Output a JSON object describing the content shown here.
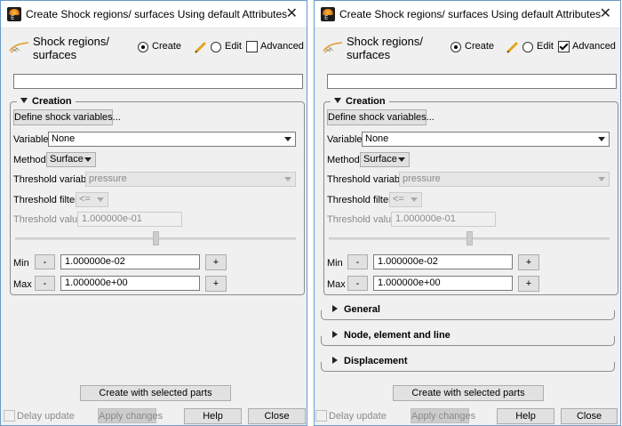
{
  "windows": [
    {
      "title": "Create Shock regions/ surfaces Using default Attributes",
      "tool_title_line1": "Shock regions/",
      "tool_title_line2": "surfaces",
      "mode_create": "Create",
      "mode_edit": "Edit",
      "advanced": "Advanced",
      "advanced_checked": false,
      "name_value": "",
      "creation": {
        "header": "Creation",
        "define_button": "Define shock variables...",
        "variable_label": "Variable",
        "variable_value": "None",
        "method_label": "Method",
        "method_value": "Surface",
        "threshold_variable_label": "Threshold variable",
        "threshold_variable_value": "pressure",
        "threshold_filter_label": "Threshold filter",
        "threshold_filter_value": "<=",
        "threshold_value_label": "Threshold value",
        "threshold_value": "1.000000e-01",
        "slider_level": 0.5,
        "min_label": "Min",
        "min_value": "1.000000e-02",
        "max_label": "Max",
        "max_value": "1.000000e+00",
        "minus": "-",
        "plus": "+"
      },
      "collapsed_sections": [],
      "create_button": "Create with selected parts",
      "delay_update": "Delay update",
      "apply_changes": "Apply changes",
      "help": "Help",
      "close": "Close"
    },
    {
      "title": "Create Shock regions/ surfaces Using default Attributes",
      "tool_title_line1": "Shock regions/",
      "tool_title_line2": "surfaces",
      "mode_create": "Create",
      "mode_edit": "Edit",
      "advanced": "Advanced",
      "advanced_checked": true,
      "name_value": "",
      "creation": {
        "header": "Creation",
        "define_button": "Define shock variables...",
        "variable_label": "Variable",
        "variable_value": "None",
        "method_label": "Method",
        "method_value": "Surface",
        "threshold_variable_label": "Threshold variable",
        "threshold_variable_value": "pressure",
        "threshold_filter_label": "Threshold filter",
        "threshold_filter_value": "<=",
        "threshold_value_label": "Threshold value",
        "threshold_value": "1.000000e-01",
        "slider_level": 0.5,
        "min_label": "Min",
        "min_value": "1.000000e-02",
        "max_label": "Max",
        "max_value": "1.000000e+00",
        "minus": "-",
        "plus": "+"
      },
      "collapsed_sections": [
        "General",
        "Node, element and line",
        "Displacement"
      ],
      "create_button": "Create with selected parts",
      "delay_update": "Delay update",
      "apply_changes": "Apply changes",
      "help": "Help",
      "close": "Close"
    }
  ],
  "icons": {
    "app": "ensight-app-icon",
    "close": "close-icon",
    "tool": "shock-surface-icon",
    "edit": "pencil-icon",
    "expand": "triangle-down-icon",
    "collapse": "triangle-right-icon"
  }
}
